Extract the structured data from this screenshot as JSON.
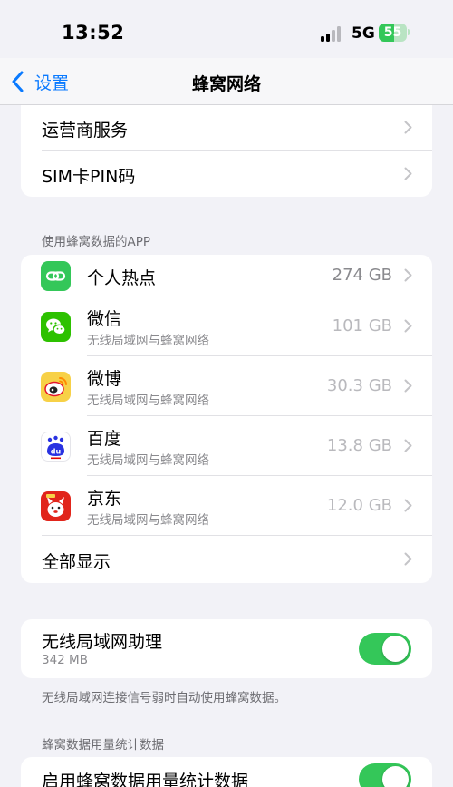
{
  "status_bar": {
    "time": "13:52",
    "network": "5G",
    "battery": "55",
    "battery_level": 0.55
  },
  "nav": {
    "back_label": "设置",
    "title": "蜂窝网络"
  },
  "top_group": {
    "items": [
      {
        "label": "运营商服务"
      },
      {
        "label": "SIM卡PIN码"
      }
    ]
  },
  "apps_section": {
    "header": "使用蜂窝数据的APP",
    "items": [
      {
        "name": "个人热点",
        "subtitle": "",
        "usage": "274 GB",
        "icon": "hotspot-icon"
      },
      {
        "name": "微信",
        "subtitle": "无线局域网与蜂窝网络",
        "usage": "101 GB",
        "icon": "wechat-icon"
      },
      {
        "name": "微博",
        "subtitle": "无线局域网与蜂窝网络",
        "usage": "30.3 GB",
        "icon": "weibo-icon"
      },
      {
        "name": "百度",
        "subtitle": "无线局域网与蜂窝网络",
        "usage": "13.8 GB",
        "icon": "baidu-icon"
      },
      {
        "name": "京东",
        "subtitle": "无线局域网与蜂窝网络",
        "usage": "12.0 GB",
        "icon": "jd-icon"
      }
    ],
    "show_all": "全部显示"
  },
  "wifi_assist": {
    "label": "无线局域网助理",
    "size": "342 MB",
    "enabled": true,
    "note": "无线局域网连接信号弱时自动使用蜂窝数据。"
  },
  "stats_section": {
    "header": "蜂窝数据用量统计数据",
    "label": "启用蜂窝数据用量统计数据",
    "enabled": true
  },
  "colors": {
    "accent": "#0a7aff",
    "toggle_on": "#34c759",
    "background": "#f2f2f7"
  }
}
